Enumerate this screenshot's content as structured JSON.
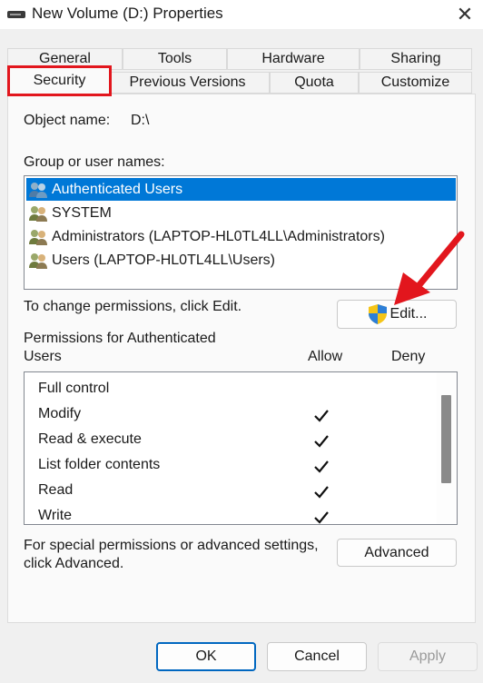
{
  "window": {
    "title": "New Volume (D:) Properties",
    "close_glyph": "✕"
  },
  "tabs": {
    "row1": [
      "General",
      "Tools",
      "Hardware",
      "Sharing"
    ],
    "row2": [
      "Security",
      "Previous Versions",
      "Quota",
      "Customize"
    ],
    "selected": "Security"
  },
  "object": {
    "label": "Object name:",
    "value": "D:\\"
  },
  "group_label": "Group or user names:",
  "users": [
    {
      "name": "Authenticated Users",
      "selected": true,
      "icon": "users-group-icon"
    },
    {
      "name": "SYSTEM",
      "selected": false,
      "icon": "users-group-icon"
    },
    {
      "name": "Administrators (LAPTOP-HL0TL4LL\\Administrators)",
      "selected": false,
      "icon": "users-group-icon"
    },
    {
      "name": "Users (LAPTOP-HL0TL4LL\\Users)",
      "selected": false,
      "icon": "users-group-icon"
    }
  ],
  "change_hint": "To change permissions, click Edit.",
  "edit_button": {
    "label": "Edit...",
    "icon": "uac-shield-icon"
  },
  "permissions": {
    "title_line1": "Permissions for Authenticated",
    "title_line2": "Users",
    "allow_header": "Allow",
    "deny_header": "Deny",
    "rows": [
      {
        "name": "Full control",
        "allow": false,
        "deny": false
      },
      {
        "name": "Modify",
        "allow": true,
        "deny": false
      },
      {
        "name": "Read & execute",
        "allow": true,
        "deny": false
      },
      {
        "name": "List folder contents",
        "allow": true,
        "deny": false
      },
      {
        "name": "Read",
        "allow": true,
        "deny": false
      },
      {
        "name": "Write",
        "allow": true,
        "deny": false
      }
    ]
  },
  "special": {
    "line1": "For special permissions or advanced settings,",
    "line2": "click Advanced."
  },
  "advanced_button": "Advanced",
  "buttons": {
    "ok": "OK",
    "cancel": "Cancel",
    "apply": "Apply"
  },
  "colors": {
    "selection": "#0078d7",
    "highlight_box": "#e2161d",
    "arrow": "#e2161d",
    "ok_border": "#0067c0"
  }
}
